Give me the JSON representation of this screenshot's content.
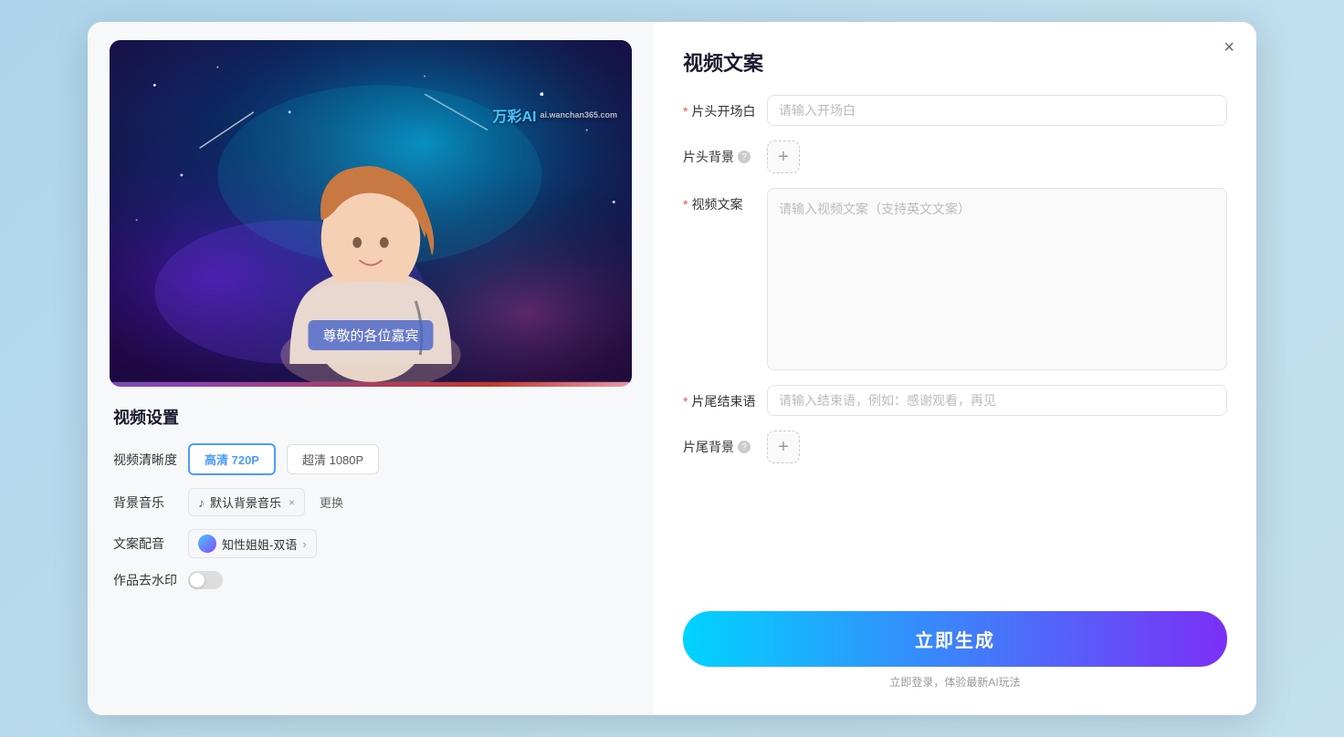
{
  "modal": {
    "close_label": "×"
  },
  "left_panel": {
    "watermark_brand": "万彩AI",
    "watermark_url": "ai.wanchan365.com",
    "subtitle_text": "尊敬的各位嘉宾",
    "settings_title": "视频设置",
    "quality_label": "视频清晰度",
    "quality_options": [
      {
        "label": "高清 720P",
        "active": true
      },
      {
        "label": "超清 1080P",
        "active": false
      }
    ],
    "music_label": "背景音乐",
    "music_name": "默认背景音乐",
    "music_remove": "×",
    "music_change": "更换",
    "voice_label": "文案配音",
    "voice_name": "知性姐姐-双语",
    "watermark_label": "作品去水印"
  },
  "right_panel": {
    "title": "视频文案",
    "opening_label": "片头开场白",
    "opening_placeholder": "请输入开场白",
    "opening_required": true,
    "header_bg_label": "片头背景",
    "header_bg_help": "?",
    "content_label": "视频文案",
    "content_placeholder": "请输入视频文案（支持英文文案）",
    "content_required": true,
    "ending_label": "片尾结束语",
    "ending_placeholder": "请输入结束语，例如：感谢观看，再见",
    "ending_required": true,
    "footer_bg_label": "片尾背景",
    "footer_bg_help": "?",
    "generate_btn": "立即生成",
    "login_hint": "立即登录，体验最新AI玩法"
  }
}
